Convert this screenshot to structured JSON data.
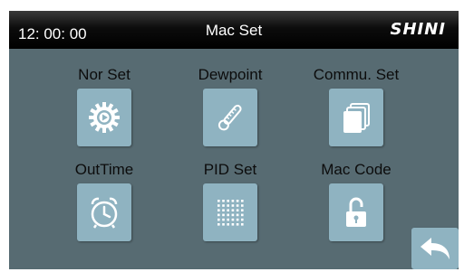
{
  "header": {
    "time": "12: 00: 00",
    "title": "Mac Set",
    "logo": "SHINI"
  },
  "menu": [
    {
      "label": "Nor Set",
      "icon": "gear-icon"
    },
    {
      "label": "Dewpoint",
      "icon": "thermometer-icon"
    },
    {
      "label": "Commu. Set",
      "icon": "stacked-pages-icon"
    },
    {
      "label": "OutTime",
      "icon": "alarm-clock-icon"
    },
    {
      "label": "PID Set",
      "icon": "dot-grid-icon"
    },
    {
      "label": "Mac Code",
      "icon": "unlocked-padlock-icon"
    }
  ],
  "back": {
    "icon": "back-arrow-icon"
  },
  "colors": {
    "screen_bg": "#576b72",
    "tile_bg": "#8fb3c1",
    "header_bg": "#000000",
    "label_text": "#0c0c0c",
    "icon": "#ffffff"
  }
}
